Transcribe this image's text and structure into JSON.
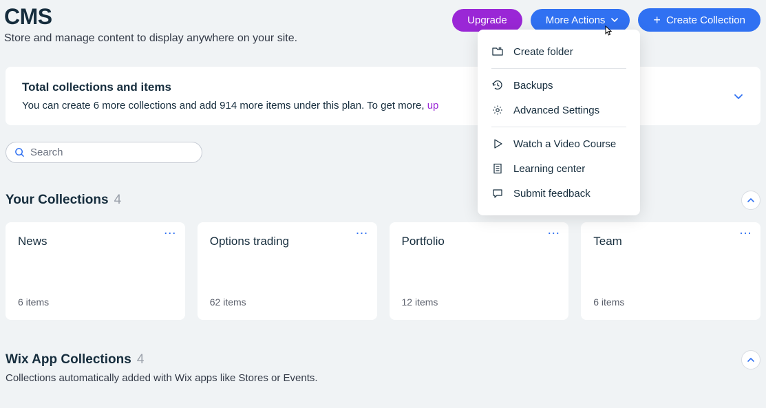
{
  "header": {
    "title": "CMS",
    "subtitle": "Store and manage content to display anywhere on your site.",
    "upgrade_label": "Upgrade",
    "more_actions_label": "More Actions",
    "create_collection_label": "Create Collection"
  },
  "banner": {
    "title": "Total collections and items",
    "text_prefix": "You can create 6 more collections and add 914 more items under this plan. To get more, ",
    "link_text": "up"
  },
  "search": {
    "placeholder": "Search"
  },
  "your_collections": {
    "title": "Your Collections",
    "count": "4",
    "items": [
      {
        "title": "News",
        "count": "6 items"
      },
      {
        "title": "Options trading",
        "count": "62 items"
      },
      {
        "title": "Portfolio",
        "count": "12 items"
      },
      {
        "title": "Team",
        "count": "6 items"
      }
    ]
  },
  "wix_collections": {
    "title": "Wix App Collections",
    "count": "4",
    "subtitle": "Collections automatically added with Wix apps like Stores or Events."
  },
  "dropdown": {
    "create_folder": "Create folder",
    "backups": "Backups",
    "advanced_settings": "Advanced Settings",
    "watch_video": "Watch a Video Course",
    "learning_center": "Learning center",
    "submit_feedback": "Submit feedback"
  }
}
